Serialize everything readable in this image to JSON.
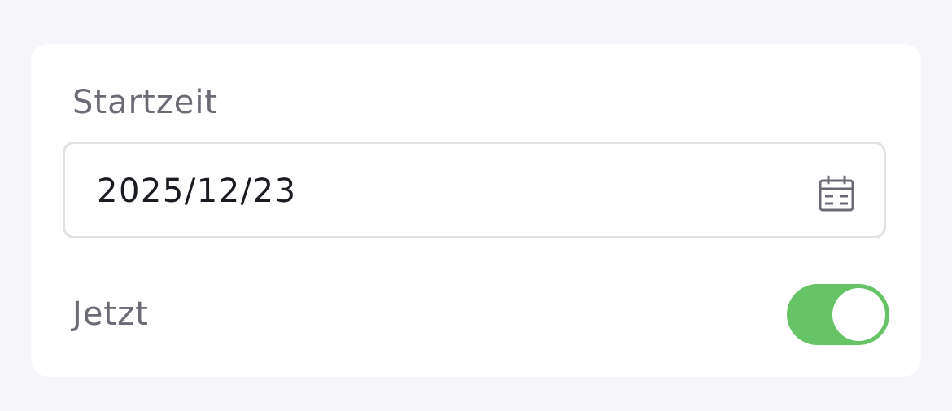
{
  "start_time": {
    "label": "Startzeit",
    "value": "2025/12/23",
    "icon": "calendar-icon"
  },
  "now_toggle": {
    "label": "Jetzt",
    "checked": true,
    "on_color": "#66c466"
  }
}
